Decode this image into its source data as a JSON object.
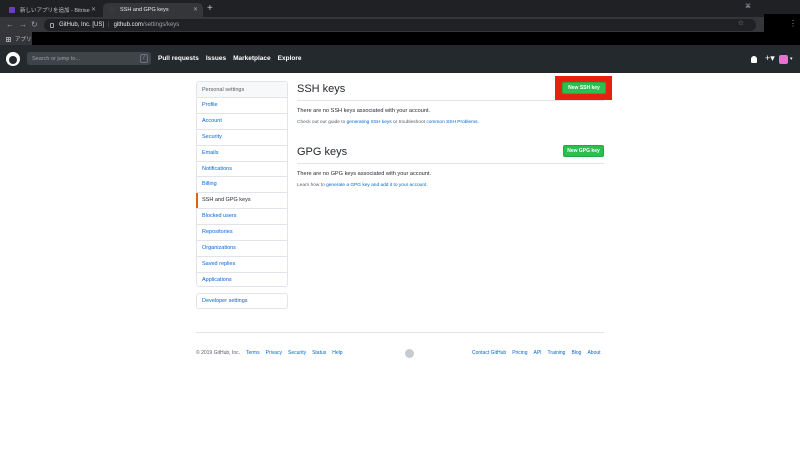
{
  "browser": {
    "tabs": [
      {
        "title": "新しいアプリを追加 - Bitrise",
        "favicon_color": "#6c3fb6"
      },
      {
        "title": "SSH and GPG keys",
        "favicon_color": "#3a3a3a"
      }
    ],
    "url_site": "GitHub, Inc. [US]",
    "url_host": "github.com",
    "url_path": "/settings/keys",
    "bookmark_label": "アプリ"
  },
  "header": {
    "search_placeholder": "Search or jump to...",
    "search_shortcut": "/",
    "nav": [
      "Pull requests",
      "Issues",
      "Marketplace",
      "Explore"
    ]
  },
  "sidebar": {
    "heading": "Personal settings",
    "items": [
      {
        "label": "Profile"
      },
      {
        "label": "Account"
      },
      {
        "label": "Security"
      },
      {
        "label": "Emails"
      },
      {
        "label": "Notifications"
      },
      {
        "label": "Billing"
      },
      {
        "label": "SSH and GPG keys"
      },
      {
        "label": "Blocked users"
      },
      {
        "label": "Repositories"
      },
      {
        "label": "Organizations"
      },
      {
        "label": "Saved replies"
      },
      {
        "label": "Applications"
      }
    ],
    "selected_index": 6,
    "developer_settings": "Developer settings"
  },
  "ssh": {
    "title": "SSH keys",
    "button": "New SSH key",
    "empty": "There are no SSH keys associated with your account.",
    "guide_pre": "Check out our guide to ",
    "guide_link": "generating SSH keys",
    "guide_mid": " or troubleshoot ",
    "guide_link2": "common SSH Problems",
    "guide_post": "."
  },
  "gpg": {
    "title": "GPG keys",
    "button": "New GPG key",
    "empty": "There are no GPG keys associated with your account.",
    "learn_pre": "Learn how to ",
    "learn_link": "generate a GPG key and add it to your account",
    "learn_post": "."
  },
  "footer": {
    "copyright": "© 2019 GitHub, Inc.",
    "left_links": [
      "Terms",
      "Privacy",
      "Security",
      "Status",
      "Help"
    ],
    "right_links": [
      "Contact GitHub",
      "Pricing",
      "API",
      "Training",
      "Blog",
      "About"
    ]
  },
  "colors": {
    "header_bg": "#24292e",
    "link": "#0366d6",
    "green_button": "#2cbe4e",
    "highlight": "#e8210f",
    "selected_marker": "#e36209"
  }
}
